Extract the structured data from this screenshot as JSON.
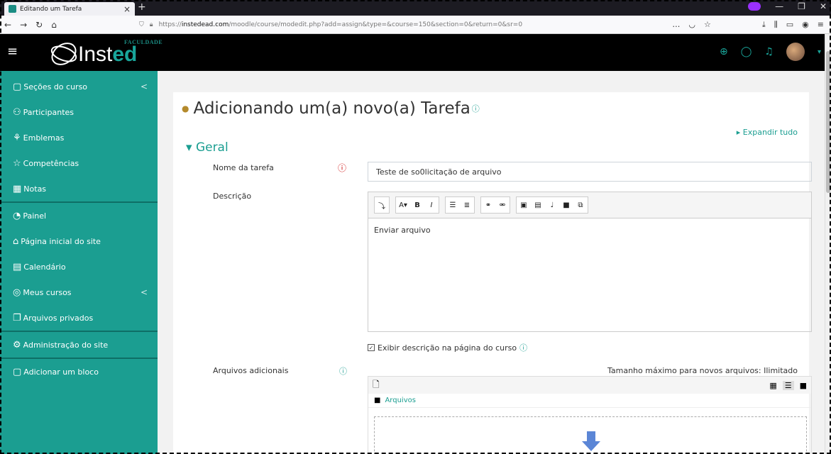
{
  "browser": {
    "tab_title": "Editando um Tarefa",
    "url_prefix": "https://",
    "url_host": "instedead.com",
    "url_path": "/moodle/course/modedit.php?add=assign&type=&course=150&section=0&return=0&sr=0"
  },
  "logo": {
    "faculdade": "FACULDADE",
    "brand_a": "Inst",
    "brand_b": "ed"
  },
  "sidebar": {
    "items": [
      {
        "label": "Seções do curso",
        "icon": "▢",
        "chevron": "<"
      },
      {
        "label": "Participantes",
        "icon": "⚇"
      },
      {
        "label": "Emblemas",
        "icon": "⚘"
      },
      {
        "label": "Competências",
        "icon": "☆"
      },
      {
        "label": "Notas",
        "icon": "▦"
      },
      {
        "label": "Painel",
        "icon": "◔"
      },
      {
        "label": "Página inicial do site",
        "icon": "⌂"
      },
      {
        "label": "Calendário",
        "icon": "▤"
      },
      {
        "label": "Meus cursos",
        "icon": "◎",
        "chevron": "<"
      },
      {
        "label": "Arquivos privados",
        "icon": "❐"
      },
      {
        "label": "Administração do site",
        "icon": "⚙"
      },
      {
        "label": "Adicionar um bloco",
        "icon": "▢"
      }
    ]
  },
  "page": {
    "title": "Adicionando um(a) novo(a) Tarefa",
    "expand_all": "Expandir tudo",
    "section": "Geral",
    "name_label": "Nome da tarefa",
    "name_value": "Teste de so0licitação de arquivo",
    "desc_label": "Descrição",
    "desc_value": "Enviar arquivo",
    "show_desc_label": "Exibir descrição na página do curso",
    "files_label": "Arquivos adicionais",
    "max_size": "Tamanho máximo para novos arquivos: Ilimitado",
    "files_path": "Arquivos"
  }
}
